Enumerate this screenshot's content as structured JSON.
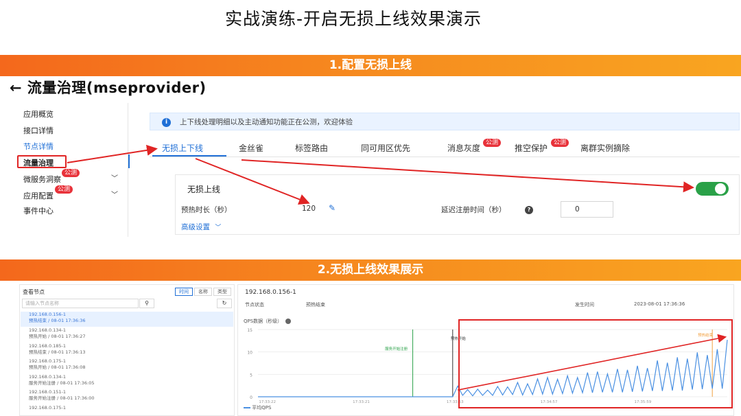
{
  "slide_title": "实战演练-开启无损上线效果演示",
  "section1_banner": "1.配置无损上线",
  "section2_banner": "2.无损上线效果展示",
  "page": {
    "back_arrow": "←",
    "title": "流量治理(mseprovider)"
  },
  "sidebar": {
    "items": [
      {
        "label": "应用概览"
      },
      {
        "label": "接口详情"
      },
      {
        "label": "节点详情"
      },
      {
        "label": "流量治理"
      },
      {
        "label": "微服务洞察",
        "badge": "公测"
      },
      {
        "label": "应用配置",
        "badge": "公测"
      },
      {
        "label": "事件中心"
      }
    ],
    "chevron": "﹀"
  },
  "notice": {
    "icon": "i",
    "text": "上下线处理明细以及主动通知功能正在公测，欢迎体验"
  },
  "tabs": [
    {
      "label": "无损上下线"
    },
    {
      "label": "金丝雀"
    },
    {
      "label": "标签路由"
    },
    {
      "label": "同可用区优先"
    },
    {
      "label": "消息灰度",
      "badge": "公测"
    },
    {
      "label": "推空保护",
      "badge": "公测"
    },
    {
      "label": "离群实例摘除"
    }
  ],
  "lossless": {
    "section_title": "无损上线",
    "enabled": true,
    "warmup_label": "预热时长（秒）",
    "warmup_value": "120",
    "edit_icon": "✎",
    "delay_label": "延迟注册时间（秒）",
    "help_icon": "?",
    "delay_value": "0",
    "advanced_label": "高级设置",
    "advanced_chevron": "﹀"
  },
  "node_panel": {
    "title": "查看节点",
    "segments": [
      "时间",
      "名称",
      "类型"
    ],
    "search_placeholder": "请输入节点名称",
    "search_icon": "⚲",
    "refresh_icon": "↻",
    "nodes": [
      {
        "ip": "192.168.0.156-1",
        "status": "预热结束 / 08-01 17:36:36"
      },
      {
        "ip": "192.168.0.134-1",
        "status": "预热开始 / 08-01 17:36:27"
      },
      {
        "ip": "192.168.0.185-1",
        "status": "预热结束 / 08-01 17:36:13"
      },
      {
        "ip": "192.168.0.175-1",
        "status": "预热开始 / 08-01 17:36:08"
      },
      {
        "ip": "192.168.0.134-1",
        "status": "服务开始注册 / 08-01 17:36:05"
      },
      {
        "ip": "192.168.0.151-1",
        "status": "服务开始注册 / 08-01 17:36:00"
      },
      {
        "ip": "192.168.0.175-1",
        "status": ""
      }
    ]
  },
  "detail_panel": {
    "node_title": "192.168.0.156-1",
    "status_key": "节点状态",
    "status_value": "预热结束",
    "time_key": "发生时间",
    "time_value": "2023-08-01 17:36:36",
    "chart_title": "QPS数据（秒级）",
    "annotations": [
      "服务开始注册",
      "预热开始",
      "预热结束"
    ],
    "legend": "平均QPS"
  },
  "chart_data": {
    "type": "line",
    "title": "QPS数据（秒级）",
    "xlabel": "",
    "ylabel": "",
    "x_ticks": [
      "17:33:22",
      "17:33:21",
      "17:33:53",
      "17:34:57",
      "17:35:59"
    ],
    "y_ticks": [
      0,
      5,
      10,
      15
    ],
    "ylim": [
      0,
      15
    ],
    "series": [
      {
        "name": "平均QPS",
        "color": "#4a90e2",
        "values": [
          0,
          0,
          0,
          0,
          0,
          0,
          0,
          0,
          0,
          0,
          0,
          0,
          0,
          0,
          0,
          0,
          0,
          0,
          0,
          0,
          0,
          0,
          0,
          0,
          0,
          0,
          0,
          0,
          0,
          0,
          0,
          0,
          0,
          0,
          0,
          0,
          0,
          0,
          0,
          0,
          2.4,
          0.3,
          1.6,
          0.2,
          1.7,
          0.3,
          1.5,
          0.3,
          2.3,
          0.4,
          2.2,
          0.5,
          3.2,
          0.4,
          2.9,
          0.5,
          4.0,
          0.6,
          4.3,
          0.6,
          3.9,
          0.7,
          4.7,
          0.8,
          4.3,
          0.9,
          5.4,
          0.9,
          5.6,
          1.0,
          5.1,
          1.0,
          6.2,
          1.0,
          6.0,
          1.1,
          6.9,
          1.2,
          6.4,
          1.3,
          8.1,
          1.3,
          7.6,
          1.4,
          8.8,
          1.4,
          8.5,
          1.6,
          9.9,
          1.7,
          9.3,
          1.8,
          10.6,
          1.8,
          12.7
        ]
      }
    ],
    "markers": [
      {
        "label": "服务开始注册",
        "color": "#2aa148"
      },
      {
        "label": "预热开始",
        "color": "#333333"
      },
      {
        "label": "预热结束",
        "color": "#f2a040"
      }
    ],
    "grid": true,
    "legend_position": "bottom-left"
  }
}
